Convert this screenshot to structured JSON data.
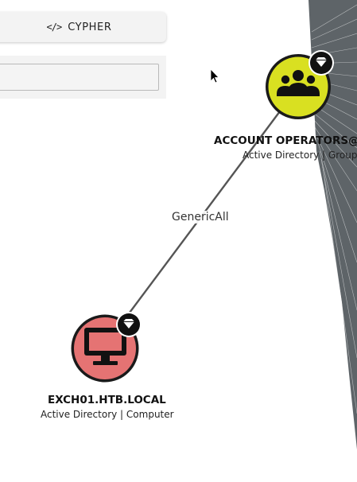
{
  "toolbar": {
    "cypher_icon": "</>",
    "cypher_label": "CYPHER"
  },
  "search": {
    "value": "",
    "placeholder": ""
  },
  "edge": {
    "label": "GenericAll"
  },
  "nodes": {
    "group": {
      "name": "ACCOUNT OPERATORS@",
      "type": "Active Directory | Group",
      "icon": "group-users-icon",
      "fill_color": "#d9e021",
      "badge": "tier-zero-gem-icon"
    },
    "computer": {
      "name": "EXCH01.HTB.LOCAL",
      "type": "Active Directory | Computer",
      "icon": "computer-monitor-icon",
      "fill_color": "#e57373",
      "badge": "tier-zero-gem-icon"
    }
  },
  "colors": {
    "edge": "#555555",
    "fan": "#5e6468",
    "ring": "#1a1a1a",
    "badge": "#111111"
  }
}
